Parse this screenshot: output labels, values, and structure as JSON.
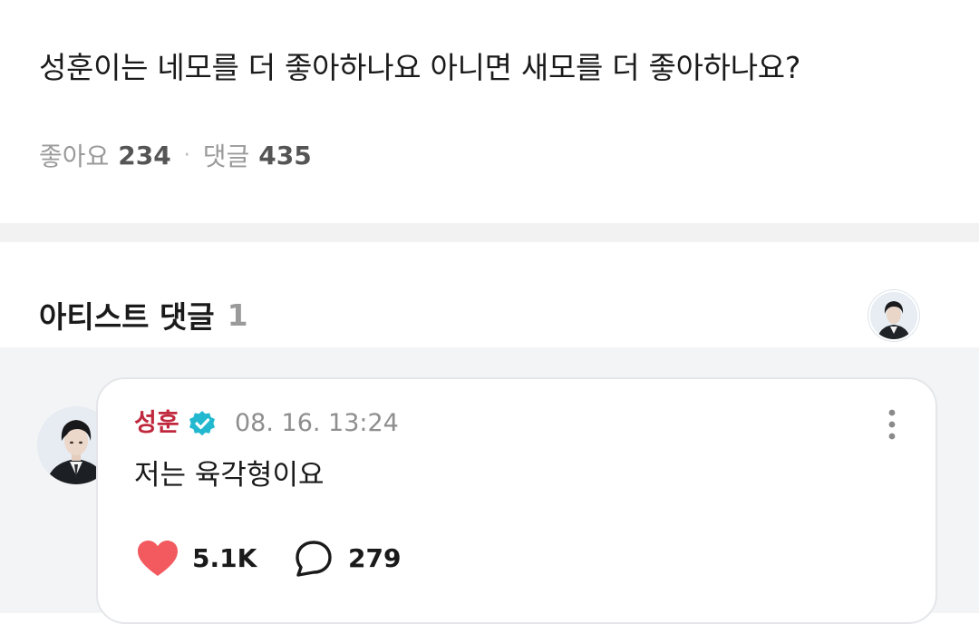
{
  "post": {
    "question": "성훈이는 네모를 더 좋아하나요 아니면 새모를 더 좋아하나요?",
    "likes_label": "좋아요",
    "likes_count": "234",
    "separator": "·",
    "comments_label": "댓글",
    "comments_count": "435"
  },
  "artist_section": {
    "title": "아티스트 댓글",
    "count": "1"
  },
  "comment": {
    "author": "성훈",
    "verified": true,
    "timestamp": "08. 16. 13:24",
    "text": "저는 육각형이요",
    "like_count": "5.1K",
    "reply_count": "279"
  },
  "colors": {
    "author_name": "#c0283d",
    "verified_badge": "#22b8cf",
    "heart": "#f25a60",
    "page_gray_band": "#f2f2f2",
    "comment_area_bg": "#f3f4f6"
  },
  "icons": {
    "verified": "verified-badge-icon",
    "more": "more-vertical-icon",
    "like": "heart-icon",
    "reply": "speech-bubble-icon"
  }
}
